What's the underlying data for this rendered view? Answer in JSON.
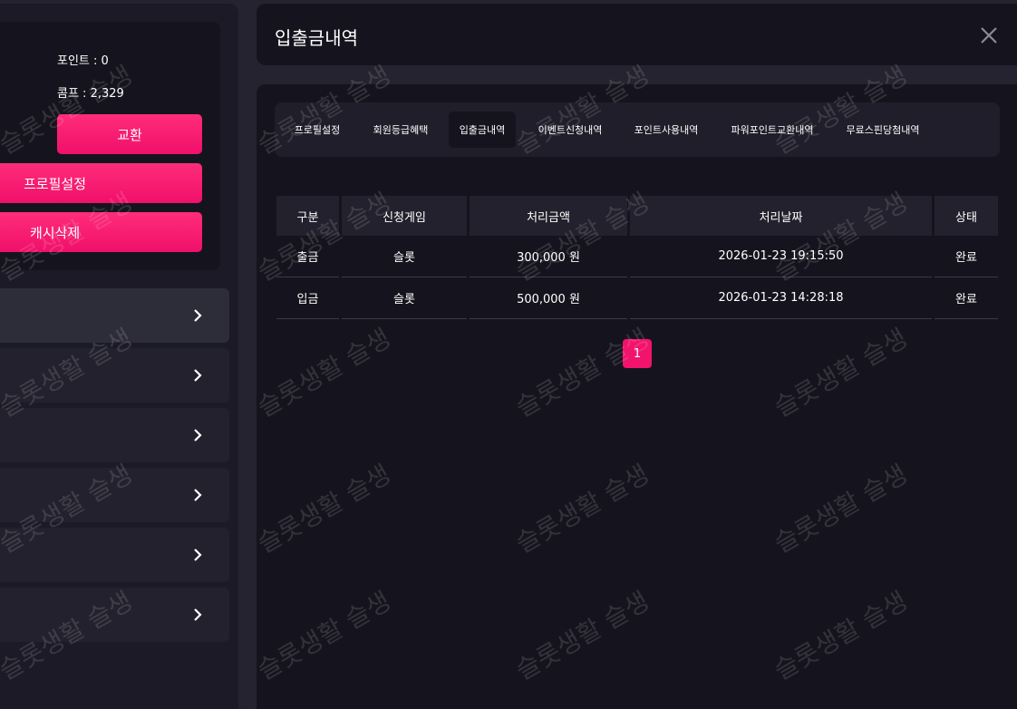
{
  "sidebar": {
    "point_label": "포인트 : 0",
    "comp_label": "콤프 : 2,329",
    "exchange_label": "교환",
    "profile_label": "프로필설정",
    "cash_delete_label": "캐시삭제"
  },
  "header": {
    "title": "입출금내역"
  },
  "tabs": [
    {
      "label": "프로필설정"
    },
    {
      "label": "회원등급혜택"
    },
    {
      "label": "입출금내역"
    },
    {
      "label": "이벤트신청내역"
    },
    {
      "label": "포인트사용내역"
    },
    {
      "label": "파워포인트교환내역"
    },
    {
      "label": "무료스핀당첨내역"
    }
  ],
  "table": {
    "headers": [
      "구분",
      "신청게임",
      "처리금액",
      "처리날짜",
      "상태"
    ],
    "rows": [
      [
        "출금",
        "슬롯",
        "300,000 원",
        "2026-01-23 19:15:50",
        "완료"
      ],
      [
        "입금",
        "슬롯",
        "500,000 원",
        "2026-01-23 14:28:18",
        "완료"
      ]
    ]
  },
  "pagination": {
    "current": "1"
  },
  "watermark": "슬롯생활 슬생",
  "colors": {
    "accent": "#f2136c",
    "panel": "#15141e",
    "background": "#24232f"
  }
}
